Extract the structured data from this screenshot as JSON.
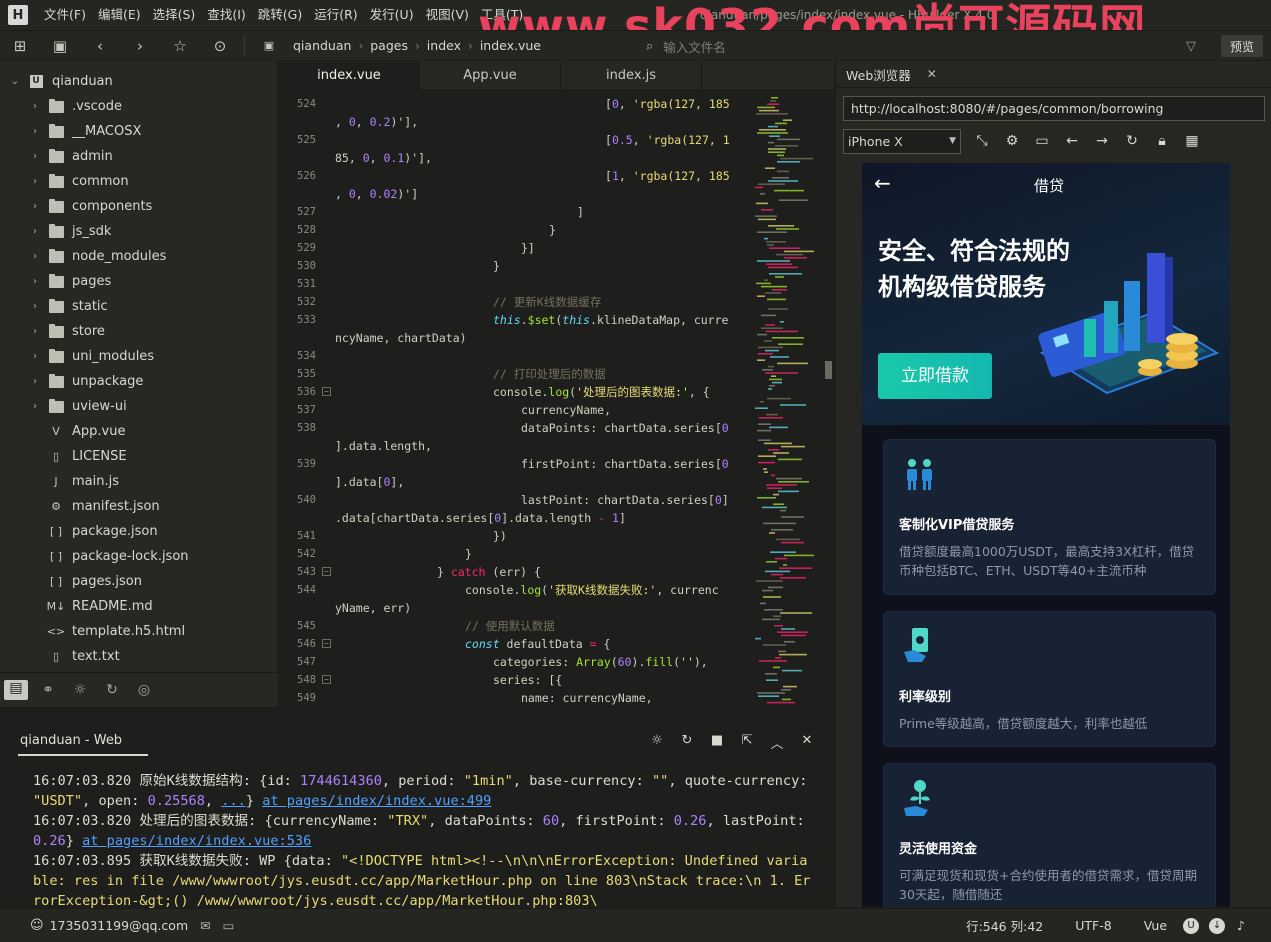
{
  "menubar": {
    "items": [
      "文件(F)",
      "编辑(E)",
      "选择(S)",
      "查找(I)",
      "跳转(G)",
      "运行(R)",
      "发行(U)",
      "视图(V)",
      "工具(T)"
    ],
    "window_title": "qianduan/pages/index/index.vue - HBuilder X 4.0"
  },
  "watermark": "www.sk032.com尚可源码网",
  "toolbar": {
    "breadcrumbs": [
      "qianduan",
      "pages",
      "index",
      "index.vue"
    ],
    "file_search_placeholder": "输入文件名",
    "preview_label": "预览"
  },
  "sidebar": {
    "root": "qianduan",
    "items": [
      {
        "label": ".vscode",
        "type": "folder"
      },
      {
        "label": "__MACOSX",
        "type": "folder"
      },
      {
        "label": "admin",
        "type": "folder"
      },
      {
        "label": "common",
        "type": "folder"
      },
      {
        "label": "components",
        "type": "folder"
      },
      {
        "label": "js_sdk",
        "type": "folder"
      },
      {
        "label": "node_modules",
        "type": "folder"
      },
      {
        "label": "pages",
        "type": "folder"
      },
      {
        "label": "static",
        "type": "folder"
      },
      {
        "label": "store",
        "type": "folder"
      },
      {
        "label": "uni_modules",
        "type": "folder"
      },
      {
        "label": "unpackage",
        "type": "folder"
      },
      {
        "label": "uview-ui",
        "type": "folder"
      },
      {
        "label": "App.vue",
        "type": "file",
        "icon": "V"
      },
      {
        "label": "LICENSE",
        "type": "file",
        "icon": "▯"
      },
      {
        "label": "main.js",
        "type": "file",
        "icon": "J"
      },
      {
        "label": "manifest.json",
        "type": "file",
        "icon": "⚙"
      },
      {
        "label": "package.json",
        "type": "file",
        "icon": "[ ]"
      },
      {
        "label": "package-lock.json",
        "type": "file",
        "icon": "[ ]"
      },
      {
        "label": "pages.json",
        "type": "file",
        "icon": "[ ]"
      },
      {
        "label": "README.md",
        "type": "file",
        "icon": "M↓"
      },
      {
        "label": "template.h5.html",
        "type": "file",
        "icon": "<>"
      },
      {
        "label": "text.txt",
        "type": "file",
        "icon": "▯"
      }
    ]
  },
  "editor": {
    "tabs": [
      "index.vue",
      "App.vue",
      "index.js"
    ],
    "active_tab": "index.vue"
  },
  "browser": {
    "tab_title": "Web浏览器",
    "url": "http://localhost:8080/#/pages/common/borrowing",
    "device": "iPhone X",
    "app": {
      "title": "借贷",
      "slogan": "安全、符合法规的机构级借贷服务",
      "cta": "立即借款",
      "cards": [
        {
          "title": "客制化VIP借贷服务",
          "desc": "借贷额度最高1000万USDT，最高支持3X杠杆，借贷币种包括BTC、ETH、USDT等40+主流币种",
          "icon": "users-icon"
        },
        {
          "title": "利率级别",
          "desc": "Prime等级越高，借贷额度越大，利率也越低",
          "icon": "money-hand-icon"
        },
        {
          "title": "灵活使用资金",
          "desc": "可满足现货和现货+合约使用者的借贷需求，借贷周期30天起，随借随还",
          "icon": "coin-plant-icon"
        }
      ]
    }
  },
  "output": {
    "tab": "qianduan - Web"
  },
  "statusbar": {
    "account": "1735031199@qq.com",
    "position": "行:546  列:42",
    "encoding": "UTF-8",
    "language": "Vue"
  },
  "colors": {
    "accent_teal": "#19c8a8",
    "watermark": "#e8425c",
    "link": "#4fa0ff"
  }
}
